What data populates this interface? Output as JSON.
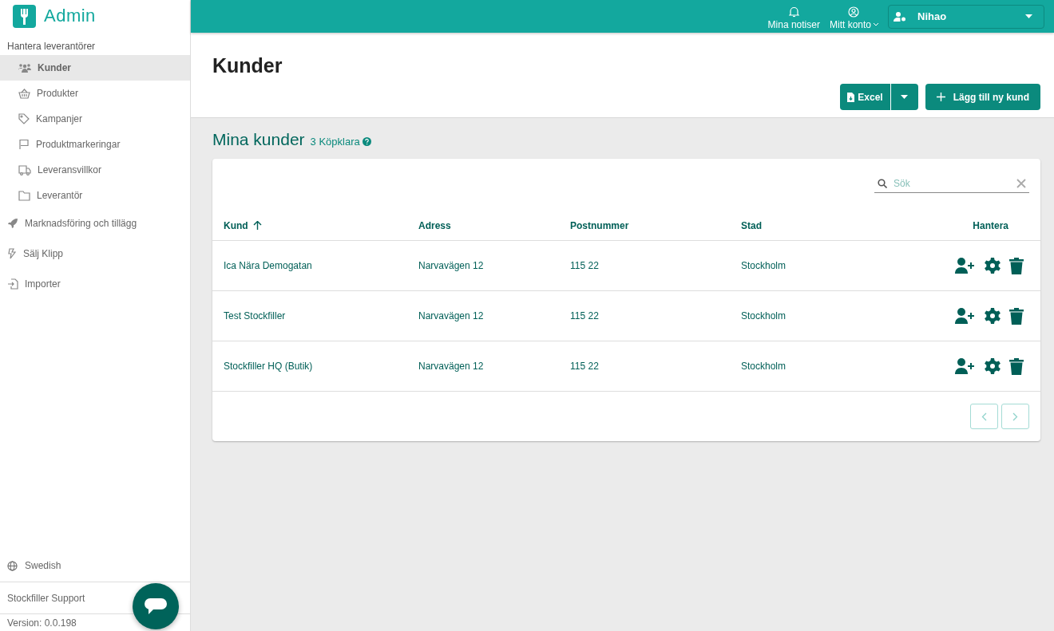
{
  "app": {
    "title": "Admin"
  },
  "sidebar": {
    "groups": [
      {
        "label": "Hantera leverantörer",
        "kind": "section",
        "children": [
          {
            "label": "Kunder",
            "selected": true
          },
          {
            "label": "Produkter",
            "selected": false
          },
          {
            "label": "Kampanjer",
            "selected": false
          },
          {
            "label": "Produktmarkeringar",
            "selected": false
          },
          {
            "label": "Leveransvillkor",
            "selected": false
          },
          {
            "label": "Leverantör",
            "selected": false
          }
        ]
      },
      {
        "label": "Marknadsföring och tillägg",
        "kind": "link",
        "selected": false
      },
      {
        "label": "Sälj Klipp",
        "kind": "link",
        "selected": false
      },
      {
        "label": "Importer",
        "kind": "link",
        "selected": false
      }
    ],
    "language": "Swedish",
    "support": "Stockfiller Support",
    "version": "Version: 0.0.198"
  },
  "topbar": {
    "notifications": "Mina notiser",
    "account": "Mitt konto",
    "supplier_select": {
      "value": "Nihao"
    }
  },
  "page": {
    "title": "Kunder",
    "buttons": [
      {
        "label": "Excel",
        "kind": "split"
      },
      {
        "label": "Lägg till ny kund",
        "kind": "add"
      }
    ]
  },
  "customers": {
    "title": "Mina kunder",
    "count": "3 Köpklara",
    "search": {
      "placeholder": "Sök"
    },
    "columns": [
      {
        "label": "Kund",
        "sorted_ascending": true
      },
      {
        "label": "Adress",
        "sorted_ascending": false
      },
      {
        "label": "Postnummer",
        "sorted_ascending": false
      },
      {
        "label": "Stad",
        "sorted_ascending": false
      },
      {
        "label": "Hantera",
        "sorted_ascending": false
      }
    ],
    "rows": [
      {
        "name": "Ica Nära Demogatan",
        "address": "Narvavägen 12",
        "zip": "115 22",
        "city": "Stockholm"
      },
      {
        "name": "Test Stockfiller",
        "address": "Narvavägen 12",
        "zip": "115 22",
        "city": "Stockholm"
      },
      {
        "name": "Stockfiller HQ (Butik)",
        "address": "Narvavägen 12",
        "zip": "115 22",
        "city": "Stockholm"
      }
    ],
    "pagination": {
      "prev_disabled": true,
      "next_disabled": true
    }
  }
}
